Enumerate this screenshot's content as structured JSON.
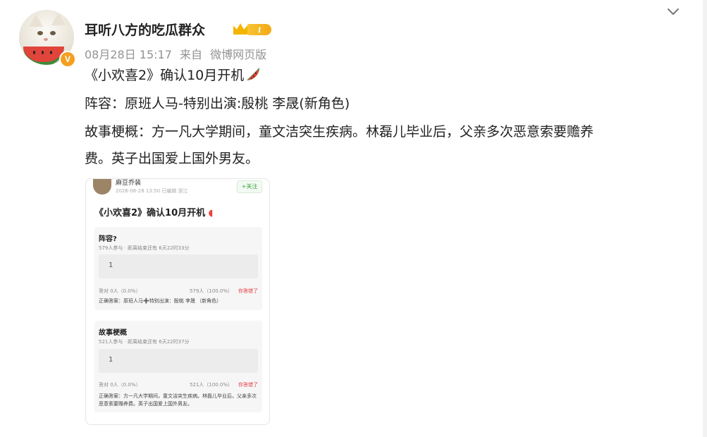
{
  "user": {
    "name": "耳听八方的吃瓜群众",
    "badge": "V",
    "vip_level": "1",
    "avatar_icon": "cat-eating-watermelon-avatar"
  },
  "meta": {
    "date": "08月28日 15:17",
    "source_prefix": "来自",
    "source": "微博网页版"
  },
  "post": {
    "line1": "《小欢喜2》确认10月开机",
    "line2": "阵容：原班人马-特别出演:殷桃 李晟(新角色)",
    "line3": "故事梗概：方一凡大学期间，童文洁突生疾病。林磊儿毕业后，父亲多次恶意索要赡养",
    "line4": "费。英子出国爱上国外男友。",
    "emoji": "watermelon-emoji"
  },
  "image": {
    "author": "麻豆乔装",
    "time_info": "2026-08-28 13:50 已编辑 浙江",
    "follow": "+关注",
    "title": "《小欢喜2》确认10月开机",
    "polls": [
      {
        "question": "阵容?",
        "participants": "579人参与 · 距离结束还有 6天22时33分",
        "option": "1",
        "left_result": "答对 0人（0.0%）",
        "right_result": "579人（100.0%）",
        "wrong": "你答错了",
        "answer": "正确答案：原班人马➕特别出演：殷桃 李晟 （新角色）"
      },
      {
        "question": "故事梗概",
        "participants": "521人参与 · 距离结束还有 6天22时37分",
        "option": "1",
        "left_result": "答对 0人（0.0%）",
        "right_result": "521人（100.0%）",
        "wrong": "你答错了",
        "answer": "正确答案：方一凡大学期间，童文洁突生疾病。林磊儿毕业后，父亲多次恶意索要赡养费。英子出国爱上国外男友。"
      }
    ]
  },
  "colors": {
    "meta_gray": "#939393",
    "vip_gold": "#f5b400",
    "verified_orange": "#f3a021",
    "follow_green": "#39a03a",
    "wrong_red": "#e4393c"
  }
}
